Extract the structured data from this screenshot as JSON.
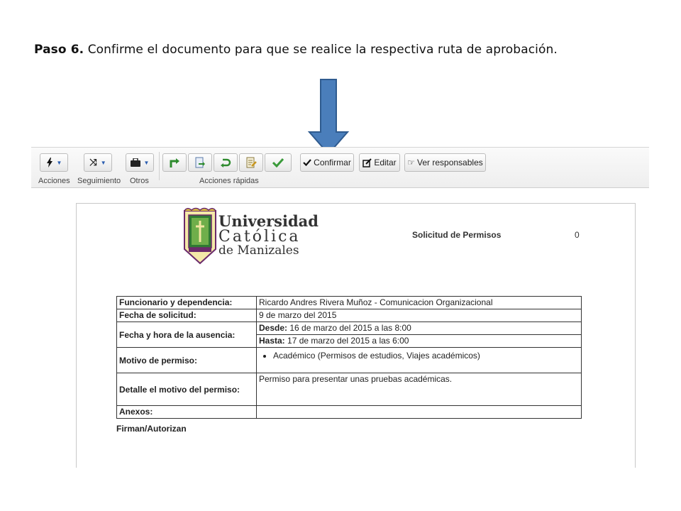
{
  "caption": {
    "step": "Paso 6.",
    "text": " Confirme el documento para que se realice la respectiva ruta de aprobación."
  },
  "toolbar": {
    "groups": [
      {
        "label": "Acciones",
        "icon": "bolt-icon"
      },
      {
        "label": "Seguimiento",
        "icon": "shuffle-icon"
      },
      {
        "label": "Otros",
        "icon": "briefcase-icon"
      }
    ],
    "quick_actions_label": "Acciones rápidas",
    "quick_actions": [
      "forward-arrow-icon",
      "document-export-icon",
      "return-arrow-icon",
      "document-edit-icon",
      "check-icon"
    ],
    "confirm_label": "Confirmar",
    "edit_label": "Editar",
    "responsibles_label": "Ver responsables"
  },
  "document": {
    "university": {
      "line1": "Universidad",
      "line2": "Católica",
      "line3": "de Manizales"
    },
    "title": "Solicitud de Permisos",
    "number": "0",
    "rows": {
      "funcionario_label": "Funcionario y dependencia:",
      "funcionario_value": "Ricardo Andres Rivera Muñoz - Comunicacion Organizacional",
      "fecha_label": "Fecha de solicitud:",
      "fecha_value": "9 de marzo del 2015",
      "ausencia_label": "Fecha y hora de la ausencia:",
      "desde_label": "Desde:",
      "desde_value": " 16 de marzo del 2015 a las 8:00",
      "hasta_label": "Hasta:",
      "hasta_value": " 17 de marzo del 2015 a las 6:00",
      "motivo_label": "Motivo de permiso:",
      "motivo_value": "Académico (Permisos de estudios, Viajes académicos)",
      "detalle_label": "Detalle el motivo del permiso:",
      "detalle_value": "Permiso para presentar unas pruebas académicas.",
      "anexos_label": "Anexos:",
      "anexos_value": ""
    },
    "firman_label": "Firman/Autorizan"
  },
  "colors": {
    "arrow": "#4a7ebb",
    "arrow_stroke": "#2f5b8f",
    "green_icon": "#3a9a3a",
    "caret": "#2a5db0"
  }
}
